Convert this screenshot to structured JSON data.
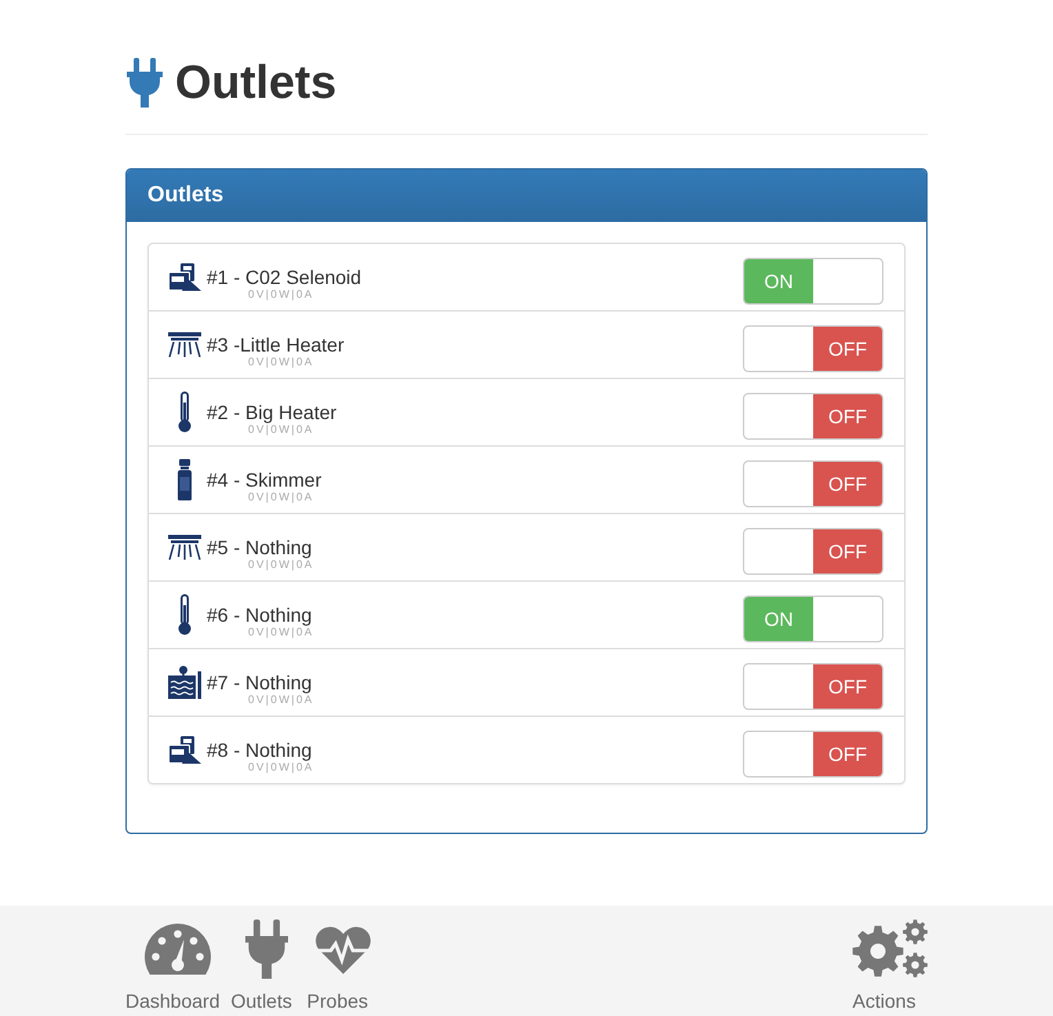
{
  "page": {
    "title": "Outlets"
  },
  "panel": {
    "title": "Outlets",
    "outlets": [
      {
        "name": "#1 - C02 Selenoid",
        "reading": "0V|0W|0A",
        "kind": "co2",
        "on": true,
        "switch_text": "ON"
      },
      {
        "name": "#3 -Little Heater",
        "reading": "0V|0W|0A",
        "kind": "lightbar",
        "on": false,
        "switch_text": "OFF"
      },
      {
        "name": "#2 - Big Heater",
        "reading": "0V|0W|0A",
        "kind": "thermometer",
        "on": false,
        "switch_text": "OFF"
      },
      {
        "name": "#4 - Skimmer",
        "reading": "0V|0W|0A",
        "kind": "bottle",
        "on": false,
        "switch_text": "OFF"
      },
      {
        "name": "#5 - Nothing",
        "reading": "0V|0W|0A",
        "kind": "lightbar",
        "on": false,
        "switch_text": "OFF"
      },
      {
        "name": "#6 - Nothing",
        "reading": "0V|0W|0A",
        "kind": "thermometer",
        "on": true,
        "switch_text": "ON"
      },
      {
        "name": "#7 - Nothing",
        "reading": "0V|0W|0A",
        "kind": "tank",
        "on": false,
        "switch_text": "OFF"
      },
      {
        "name": "#8 - Nothing",
        "reading": "0V|0W|0A",
        "kind": "co2",
        "on": false,
        "switch_text": "OFF"
      }
    ]
  },
  "footer": {
    "nav": [
      {
        "label": "Dashboard",
        "kind": "gauge"
      },
      {
        "label": "Outlets",
        "kind": "plug"
      },
      {
        "label": "Probes",
        "kind": "heart"
      }
    ],
    "actions": {
      "label": "Actions"
    }
  }
}
